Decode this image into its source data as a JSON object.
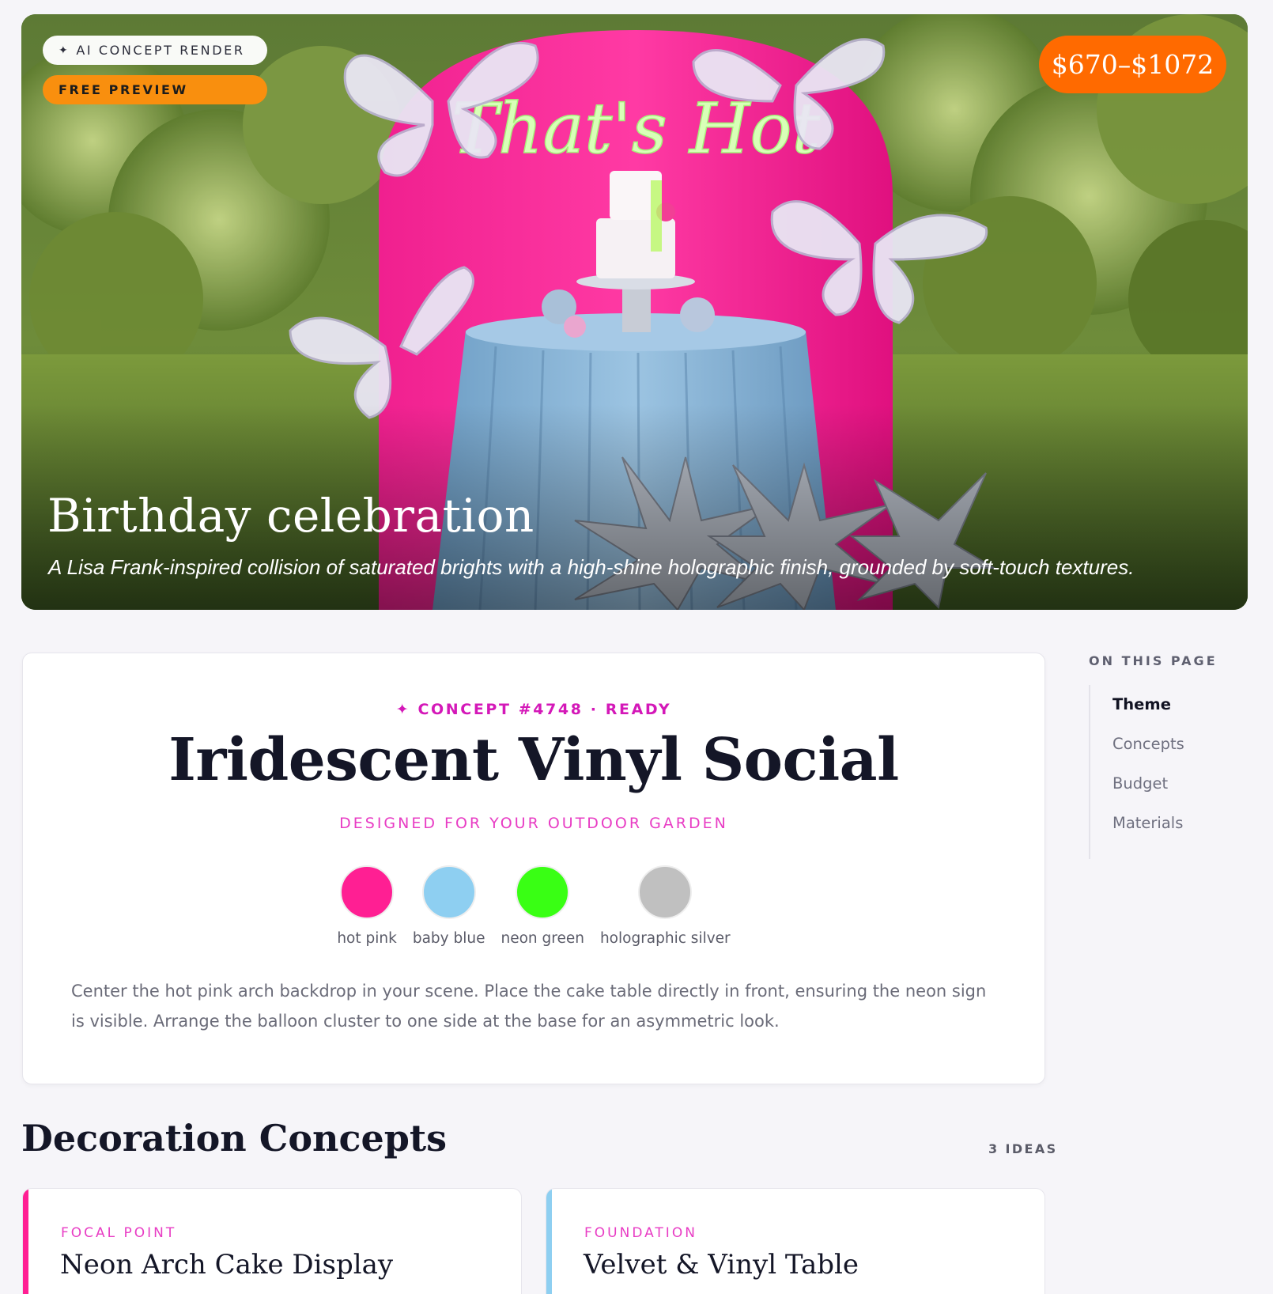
{
  "hero": {
    "badge_ai": "AI CONCEPT RENDER",
    "badge_ai_icon": "sparkle-icon",
    "badge_free": "FREE PREVIEW",
    "price": "$670–$1072",
    "title": "Birthday celebration",
    "subtitle": "A Lisa Frank-inspired collision of saturated brights with a high-shine holographic finish, grounded by soft-touch textures.",
    "sign_text": "That's Hot"
  },
  "theme": {
    "tag": "✦ CONCEPT #4748 · READY",
    "title": "Iridescent Vinyl Social",
    "designed_for": "DESIGNED FOR YOUR OUTDOOR GARDEN",
    "palette": [
      {
        "name": "hot pink",
        "color": "#ff1f93"
      },
      {
        "name": "baby blue",
        "color": "#8ecff1"
      },
      {
        "name": "neon green",
        "color": "#39ff14"
      },
      {
        "name": "holographic silver",
        "color": "#c0c0c0"
      }
    ],
    "description": "Center the hot pink arch backdrop in your scene. Place the cake table directly in front, ensuring the neon sign is visible. Arrange the balloon cluster to one side at the base for an asymmetric look."
  },
  "toc": {
    "title": "ON THIS PAGE",
    "items": [
      "Theme",
      "Concepts",
      "Budget",
      "Materials"
    ],
    "active": "Theme"
  },
  "concepts": {
    "title": "Decoration Concepts",
    "count": "3 IDEAS",
    "cards": [
      {
        "kicker": "FOCAL POINT",
        "title": "Neon Arch Cake Display",
        "accent": "#ff1f93",
        "kicker_color": "#e83cc4"
      },
      {
        "kicker": "FOUNDATION",
        "title": "Velvet & Vinyl Table",
        "accent": "#8ecff1",
        "kicker_color": "#e83cc4"
      }
    ]
  }
}
